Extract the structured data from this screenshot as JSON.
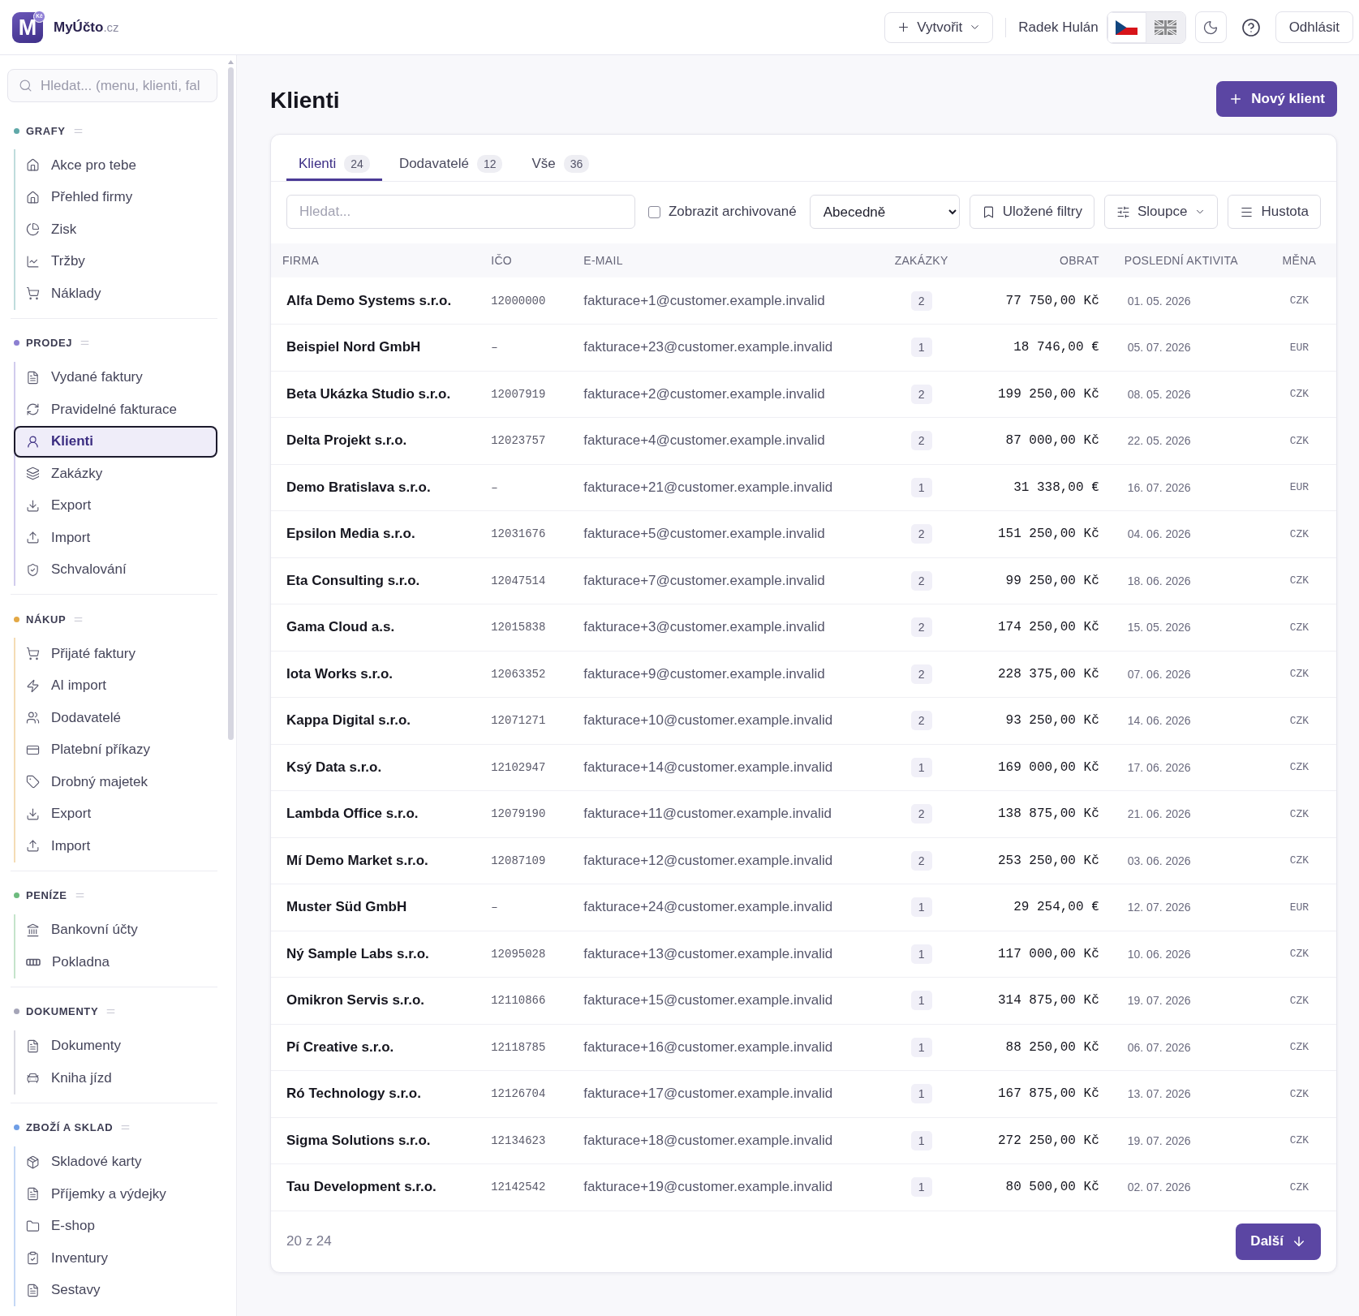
{
  "header": {
    "logo": {
      "letter": "M",
      "badge": "Kč"
    },
    "brand": {
      "name": "MyÚčto",
      "domain": ".cz"
    },
    "create_button": "Vytvořit",
    "user_name": "Radek Hulán",
    "languages": [
      {
        "kind": "cz",
        "selected": true
      },
      {
        "kind": "gb",
        "selected": false
      }
    ],
    "logout_button": "Odhlásit"
  },
  "sidebar": {
    "search": {
      "placeholder": "Hledat... (menu, klienti, fal"
    },
    "sections": [
      {
        "title": "GRAFY",
        "color": "#5fa8a8",
        "items": [
          {
            "label": "Akce pro tebe",
            "selected": false
          },
          {
            "label": "Přehled firmy",
            "selected": false
          },
          {
            "label": "Zisk",
            "selected": false
          },
          {
            "label": "Tržby",
            "selected": false
          },
          {
            "label": "Náklady",
            "selected": false
          }
        ]
      },
      {
        "title": "PRODEJ",
        "color": "#8c7fd1",
        "items": [
          {
            "label": "Vydané faktury",
            "selected": false
          },
          {
            "label": "Pravidelné fakturace",
            "selected": false
          },
          {
            "label": "Klienti",
            "selected": true
          },
          {
            "label": "Zakázky",
            "selected": false
          },
          {
            "label": "Export",
            "selected": false
          },
          {
            "label": "Import",
            "selected": false
          },
          {
            "label": "Schvalování",
            "selected": false
          }
        ]
      },
      {
        "title": "NÁKUP",
        "color": "#e3a845",
        "items": [
          {
            "label": "Přijaté faktury",
            "selected": false
          },
          {
            "label": "AI import",
            "selected": false
          },
          {
            "label": "Dodavatelé",
            "selected": false
          },
          {
            "label": "Platební příkazy",
            "selected": false
          },
          {
            "label": "Drobný majetek",
            "selected": false
          },
          {
            "label": "Export",
            "selected": false
          },
          {
            "label": "Import",
            "selected": false
          }
        ]
      },
      {
        "title": "PENÍZE",
        "color": "#6dbb7e",
        "items": [
          {
            "label": "Bankovní účty",
            "selected": false
          },
          {
            "label": "Pokladna",
            "selected": false
          }
        ]
      },
      {
        "title": "DOKUMENTY",
        "color": "#a5a5b8",
        "items": [
          {
            "label": "Dokumenty",
            "selected": false
          },
          {
            "label": "Kniha jízd",
            "selected": false
          }
        ]
      },
      {
        "title": "ZBOŽÍ A SKLAD",
        "color": "#6f9ee6",
        "items": [
          {
            "label": "Skladové karty",
            "selected": false
          },
          {
            "label": "Příjemky a výdejky",
            "selected": false
          },
          {
            "label": "E-shop",
            "selected": false
          },
          {
            "label": "Inventury",
            "selected": false
          },
          {
            "label": "Sestavy",
            "selected": false
          }
        ]
      }
    ]
  },
  "page": {
    "title": "Klienti",
    "new_button": "Nový klient"
  },
  "tabs": [
    {
      "label": "Klienti",
      "count": "24",
      "selected": true
    },
    {
      "label": "Dodavatelé",
      "count": "12",
      "selected": false
    },
    {
      "label": "Vše",
      "count": "36",
      "selected": false
    }
  ],
  "filters": {
    "search": {
      "placeholder": "Hledat..."
    },
    "archived": {
      "label": "Zobrazit archivované",
      "checked": false
    },
    "sort": {
      "value": "Abecedně"
    },
    "buttons": [
      {
        "label": "Uložené filtry",
        "dropdown": false
      },
      {
        "label": "Sloupce",
        "dropdown": true
      },
      {
        "label": "Hustota",
        "dropdown": false
      }
    ]
  },
  "table": {
    "columns": [
      "FIRMA",
      "IČO",
      "E-MAIL",
      "ZAKÁZKY",
      "OBRAT",
      "POSLEDNÍ AKTIVITA",
      "MĚNA"
    ],
    "rows": [
      {
        "company": "Alfa Demo Systems s.r.o.",
        "ico": "12000000",
        "email": "fakturace+1@customer.example.invalid",
        "orders": "2",
        "turnover": "77 750,00 Kč",
        "last_activity": "01. 05. 2026",
        "currency": "CZK"
      },
      {
        "company": "Beispiel Nord GmbH",
        "ico": "–",
        "email": "fakturace+23@customer.example.invalid",
        "orders": "1",
        "turnover": "18 746,00 €",
        "last_activity": "05. 07. 2026",
        "currency": "EUR"
      },
      {
        "company": "Beta Ukázka Studio s.r.o.",
        "ico": "12007919",
        "email": "fakturace+2@customer.example.invalid",
        "orders": "2",
        "turnover": "199 250,00 Kč",
        "last_activity": "08. 05. 2026",
        "currency": "CZK"
      },
      {
        "company": "Delta Projekt s.r.o.",
        "ico": "12023757",
        "email": "fakturace+4@customer.example.invalid",
        "orders": "2",
        "turnover": "87 000,00 Kč",
        "last_activity": "22. 05. 2026",
        "currency": "CZK"
      },
      {
        "company": "Demo Bratislava s.r.o.",
        "ico": "–",
        "email": "fakturace+21@customer.example.invalid",
        "orders": "1",
        "turnover": "31 338,00 €",
        "last_activity": "16. 07. 2026",
        "currency": "EUR"
      },
      {
        "company": "Epsilon Media s.r.o.",
        "ico": "12031676",
        "email": "fakturace+5@customer.example.invalid",
        "orders": "2",
        "turnover": "151 250,00 Kč",
        "last_activity": "04. 06. 2026",
        "currency": "CZK"
      },
      {
        "company": "Eta Consulting s.r.o.",
        "ico": "12047514",
        "email": "fakturace+7@customer.example.invalid",
        "orders": "2",
        "turnover": "99 250,00 Kč",
        "last_activity": "18. 06. 2026",
        "currency": "CZK"
      },
      {
        "company": "Gama Cloud a.s.",
        "ico": "12015838",
        "email": "fakturace+3@customer.example.invalid",
        "orders": "2",
        "turnover": "174 250,00 Kč",
        "last_activity": "15. 05. 2026",
        "currency": "CZK"
      },
      {
        "company": "Iota Works s.r.o.",
        "ico": "12063352",
        "email": "fakturace+9@customer.example.invalid",
        "orders": "2",
        "turnover": "228 375,00 Kč",
        "last_activity": "07. 06. 2026",
        "currency": "CZK"
      },
      {
        "company": "Kappa Digital s.r.o.",
        "ico": "12071271",
        "email": "fakturace+10@customer.example.invalid",
        "orders": "2",
        "turnover": "93 250,00 Kč",
        "last_activity": "14. 06. 2026",
        "currency": "CZK"
      },
      {
        "company": "Ksý Data s.r.o.",
        "ico": "12102947",
        "email": "fakturace+14@customer.example.invalid",
        "orders": "1",
        "turnover": "169 000,00 Kč",
        "last_activity": "17. 06. 2026",
        "currency": "CZK"
      },
      {
        "company": "Lambda Office s.r.o.",
        "ico": "12079190",
        "email": "fakturace+11@customer.example.invalid",
        "orders": "2",
        "turnover": "138 875,00 Kč",
        "last_activity": "21. 06. 2026",
        "currency": "CZK"
      },
      {
        "company": "Mí Demo Market s.r.o.",
        "ico": "12087109",
        "email": "fakturace+12@customer.example.invalid",
        "orders": "2",
        "turnover": "253 250,00 Kč",
        "last_activity": "03. 06. 2026",
        "currency": "CZK"
      },
      {
        "company": "Muster Süd GmbH",
        "ico": "–",
        "email": "fakturace+24@customer.example.invalid",
        "orders": "1",
        "turnover": "29 254,00 €",
        "last_activity": "12. 07. 2026",
        "currency": "EUR"
      },
      {
        "company": "Ný Sample Labs s.r.o.",
        "ico": "12095028",
        "email": "fakturace+13@customer.example.invalid",
        "orders": "1",
        "turnover": "117 000,00 Kč",
        "last_activity": "10. 06. 2026",
        "currency": "CZK"
      },
      {
        "company": "Omikron Servis s.r.o.",
        "ico": "12110866",
        "email": "fakturace+15@customer.example.invalid",
        "orders": "1",
        "turnover": "314 875,00 Kč",
        "last_activity": "19. 07. 2026",
        "currency": "CZK"
      },
      {
        "company": "Pí Creative s.r.o.",
        "ico": "12118785",
        "email": "fakturace+16@customer.example.invalid",
        "orders": "1",
        "turnover": "88 250,00 Kč",
        "last_activity": "06. 07. 2026",
        "currency": "CZK"
      },
      {
        "company": "Ró Technology s.r.o.",
        "ico": "12126704",
        "email": "fakturace+17@customer.example.invalid",
        "orders": "1",
        "turnover": "167 875,00 Kč",
        "last_activity": "13. 07. 2026",
        "currency": "CZK"
      },
      {
        "company": "Sigma Solutions s.r.o.",
        "ico": "12134623",
        "email": "fakturace+18@customer.example.invalid",
        "orders": "1",
        "turnover": "272 250,00 Kč",
        "last_activity": "19. 07. 2026",
        "currency": "CZK"
      },
      {
        "company": "Tau Development s.r.o.",
        "ico": "12142542",
        "email": "fakturace+19@customer.example.invalid",
        "orders": "1",
        "turnover": "80 500,00 Kč",
        "last_activity": "02. 07. 2026",
        "currency": "CZK"
      }
    ]
  },
  "footer": {
    "count": "20 z 24",
    "next_button": "Další"
  }
}
